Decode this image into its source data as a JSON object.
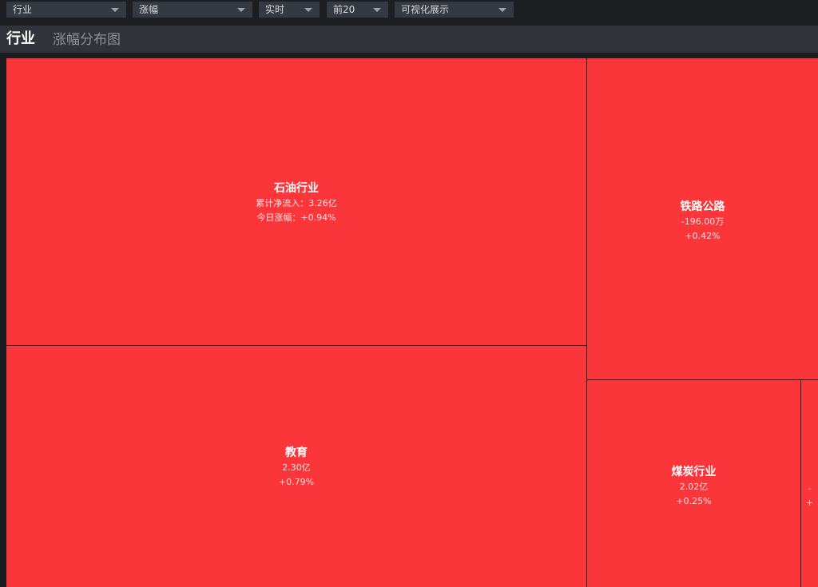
{
  "toolbar": {
    "dropdowns": [
      {
        "value": "行业"
      },
      {
        "value": "涨幅"
      },
      {
        "value": "实时"
      },
      {
        "value": "前20"
      },
      {
        "value": "可视化展示"
      }
    ]
  },
  "header": {
    "title": "行业",
    "subtitle": "涨幅分布图"
  },
  "colors": {
    "tile_up": "#fb363b",
    "background": "#1b1d21"
  },
  "treemap": {
    "tiles": [
      {
        "name": "石油行业",
        "line1": "累计净流入：3.26亿",
        "line2": "今日涨幅：+0.94%"
      },
      {
        "name": "教育",
        "line1": "2.30亿",
        "line2": "+0.79%"
      },
      {
        "name": "铁路公路",
        "line1": "-196.00万",
        "line2": "+0.42%"
      },
      {
        "name": "煤炭行业",
        "line1": "2.02亿",
        "line2": "+0.25%"
      },
      {
        "name": "",
        "line1": "-",
        "line2": "+"
      }
    ]
  }
}
